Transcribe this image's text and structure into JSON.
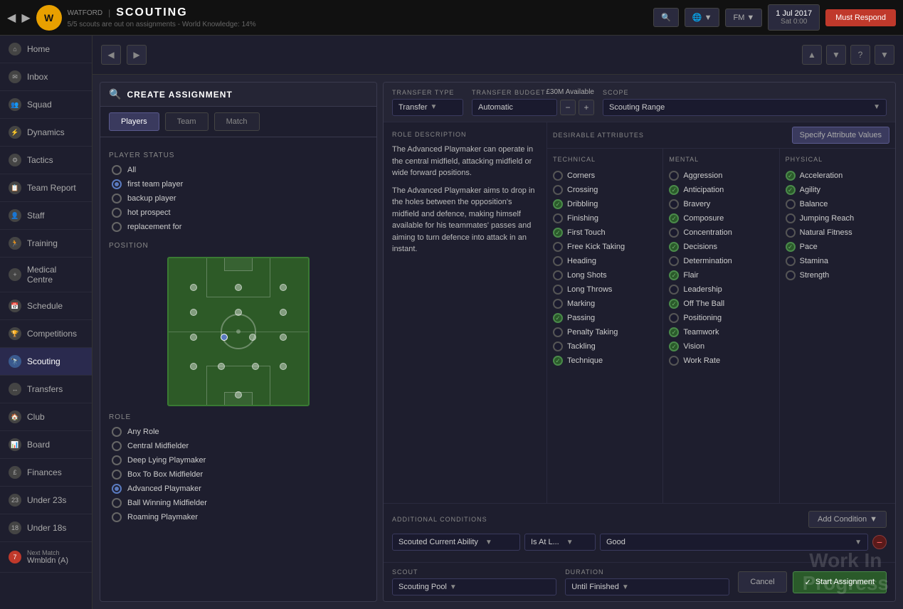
{
  "topbar": {
    "team_name": "WATFORD",
    "page_title": "SCOUTING",
    "subtitle": "5/5 scouts are out on assignments - World Knowledge: 14%",
    "date": "1 Jul 2017",
    "day": "Sat 0:00",
    "must_respond": "Must Respond",
    "nav_back": "◀",
    "nav_forward": "▶"
  },
  "sidebar": {
    "items": [
      {
        "id": "home",
        "label": "Home",
        "icon": "⌂"
      },
      {
        "id": "inbox",
        "label": "Inbox",
        "icon": "✉"
      },
      {
        "id": "squad",
        "label": "Squad",
        "icon": "👥"
      },
      {
        "id": "dynamics",
        "label": "Dynamics",
        "icon": "⚡"
      },
      {
        "id": "tactics",
        "label": "Tactics",
        "icon": "⚙"
      },
      {
        "id": "team-report",
        "label": "Team Report",
        "icon": "📋"
      },
      {
        "id": "staff",
        "label": "Staff",
        "icon": "👤"
      },
      {
        "id": "training",
        "label": "Training",
        "icon": "🏃"
      },
      {
        "id": "medical",
        "label": "Medical Centre",
        "icon": "+"
      },
      {
        "id": "schedule",
        "label": "Schedule",
        "icon": "📅"
      },
      {
        "id": "competitions",
        "label": "Competitions",
        "icon": "🏆"
      },
      {
        "id": "scouting",
        "label": "Scouting",
        "icon": "🔭",
        "active": true
      },
      {
        "id": "transfers",
        "label": "Transfers",
        "icon": "↔"
      },
      {
        "id": "club",
        "label": "Club",
        "icon": "🏠"
      },
      {
        "id": "board",
        "label": "Board",
        "icon": "📊"
      },
      {
        "id": "finances",
        "label": "Finances",
        "icon": "£"
      }
    ],
    "under23s": "Under 23s",
    "under18s": "Under 18s",
    "next_match_label": "Next Match",
    "next_match_value": "Wmbldn (A)",
    "next_match_num": "7"
  },
  "create_panel": {
    "title": "CREATE ASSIGNMENT",
    "tabs": [
      "Players",
      "Team",
      "Match"
    ],
    "active_tab": "Players",
    "player_status": {
      "title": "PLAYER STATUS",
      "options": [
        {
          "id": "all",
          "label": "All",
          "checked": false
        },
        {
          "id": "first-team",
          "label": "first team player",
          "checked": true
        },
        {
          "id": "backup",
          "label": "backup player",
          "checked": false
        },
        {
          "id": "hot-prospect",
          "label": "hot prospect",
          "checked": false
        },
        {
          "id": "replacement",
          "label": "replacement for",
          "checked": false
        }
      ]
    },
    "position_title": "POSITION",
    "role_title": "ROLE",
    "roles": [
      {
        "id": "any",
        "label": "Any Role",
        "checked": false
      },
      {
        "id": "central-mid",
        "label": "Central Midfielder",
        "checked": false
      },
      {
        "id": "deep-lying",
        "label": "Deep Lying Playmaker",
        "checked": false
      },
      {
        "id": "box-to-box",
        "label": "Box To Box Midfielder",
        "checked": false
      },
      {
        "id": "advanced",
        "label": "Advanced Playmaker",
        "checked": true
      },
      {
        "id": "ball-winning",
        "label": "Ball Winning Midfielder",
        "checked": false
      },
      {
        "id": "roaming",
        "label": "Roaming Playmaker",
        "checked": false
      }
    ]
  },
  "transfer": {
    "type_label": "TRANSFER TYPE",
    "type_value": "Transfer",
    "budget_label": "TRANSFER BUDGET",
    "budget_value": "Automatic",
    "budget_available": "£30M Available",
    "scope_label": "SCOPE",
    "scope_value": "Scouting Range"
  },
  "role_description": {
    "title": "ROLE DESCRIPTION",
    "paragraphs": [
      "The Advanced Playmaker can operate in the central midfield, attacking midfield or wide forward positions.",
      "The Advanced Playmaker aims to drop in the holes between the opposition's midfield and defence, making himself available for his teammates' passes and aiming to turn defence into attack in an instant."
    ]
  },
  "desirable_attributes": {
    "title": "DESIRABLE ATTRIBUTES",
    "specify_btn": "Specify Attribute Values",
    "technical": {
      "title": "TECHNICAL",
      "items": [
        {
          "label": "Corners",
          "checked": false
        },
        {
          "label": "Crossing",
          "checked": false
        },
        {
          "label": "Dribbling",
          "checked": true
        },
        {
          "label": "Finishing",
          "checked": false
        },
        {
          "label": "First Touch",
          "checked": true
        },
        {
          "label": "Free Kick Taking",
          "checked": false
        },
        {
          "label": "Heading",
          "checked": false
        },
        {
          "label": "Long Shots",
          "checked": false
        },
        {
          "label": "Long Throws",
          "checked": false
        },
        {
          "label": "Marking",
          "checked": false
        },
        {
          "label": "Passing",
          "checked": true
        },
        {
          "label": "Penalty Taking",
          "checked": false
        },
        {
          "label": "Tackling",
          "checked": false
        },
        {
          "label": "Technique",
          "checked": true
        }
      ]
    },
    "mental": {
      "title": "MENTAL",
      "items": [
        {
          "label": "Aggression",
          "checked": false
        },
        {
          "label": "Anticipation",
          "checked": true
        },
        {
          "label": "Bravery",
          "checked": false
        },
        {
          "label": "Composure",
          "checked": true
        },
        {
          "label": "Concentration",
          "checked": false
        },
        {
          "label": "Decisions",
          "checked": true
        },
        {
          "label": "Determination",
          "checked": false
        },
        {
          "label": "Flair",
          "checked": true
        },
        {
          "label": "Leadership",
          "checked": false
        },
        {
          "label": "Off The Ball",
          "checked": true
        },
        {
          "label": "Positioning",
          "checked": false
        },
        {
          "label": "Teamwork",
          "checked": true
        },
        {
          "label": "Vision",
          "checked": true
        },
        {
          "label": "Work Rate",
          "checked": false
        }
      ]
    },
    "physical": {
      "title": "PHYSICAL",
      "items": [
        {
          "label": "Acceleration",
          "checked": true
        },
        {
          "label": "Agility",
          "checked": true
        },
        {
          "label": "Balance",
          "checked": false
        },
        {
          "label": "Jumping Reach",
          "checked": false
        },
        {
          "label": "Natural Fitness",
          "checked": false
        },
        {
          "label": "Pace",
          "checked": true
        },
        {
          "label": "Stamina",
          "checked": false
        },
        {
          "label": "Strength",
          "checked": false
        }
      ]
    }
  },
  "conditions": {
    "title": "ADDITIONAL CONDITIONS",
    "add_btn": "Add Condition",
    "rows": [
      {
        "field": "Scouted Current Ability",
        "operator": "Is At L...",
        "value": "Good"
      }
    ]
  },
  "scout": {
    "label": "SCOUT",
    "value": "Scouting Pool"
  },
  "duration": {
    "label": "DURATION",
    "value": "Until Finished"
  },
  "actions": {
    "cancel": "Cancel",
    "start": "Start Assignment",
    "start_icon": "✓"
  },
  "watermark": {
    "line1": "Work In",
    "line2": "Progress"
  }
}
